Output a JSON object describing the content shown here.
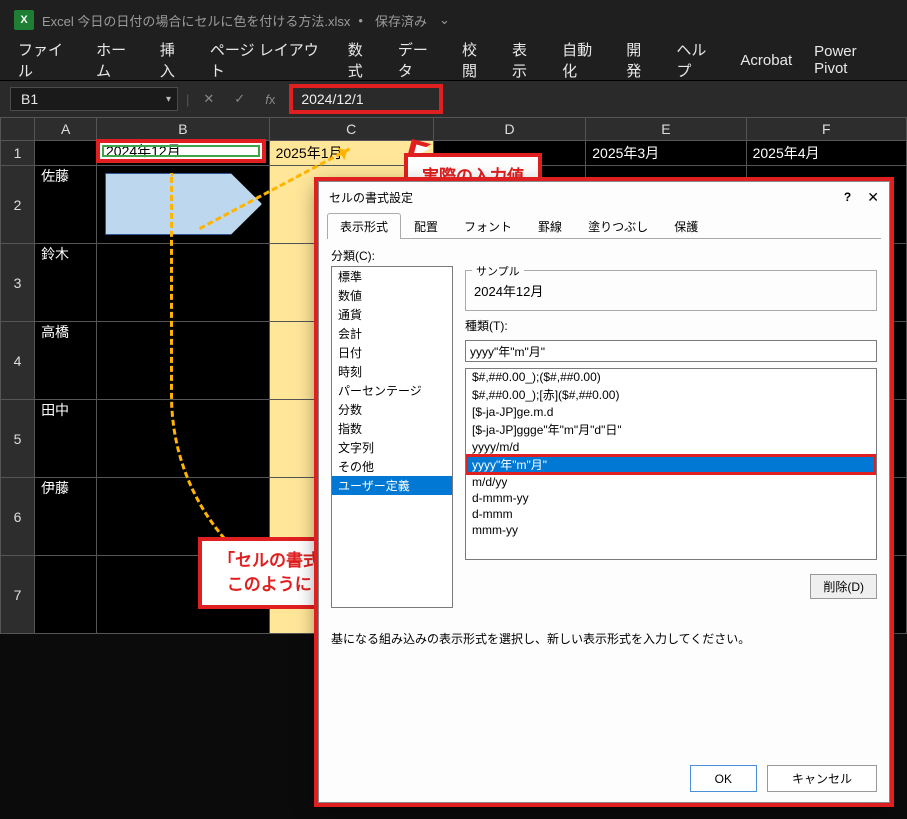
{
  "title": {
    "filename": "Excel 今日の日付の場合にセルに色を付ける方法.xlsx",
    "save_state": "保存済み"
  },
  "ribbon": [
    "ファイル",
    "ホーム",
    "挿入",
    "ページ レイアウト",
    "数式",
    "データ",
    "校閲",
    "表示",
    "自動化",
    "開発",
    "ヘルプ",
    "Acrobat",
    "Power Pivot"
  ],
  "namebox": "B1",
  "formula": "2024/12/1",
  "columns": [
    "A",
    "B",
    "C",
    "D",
    "E",
    "F"
  ],
  "row_headers": [
    "1",
    "2",
    "3",
    "4",
    "5",
    "6",
    "7"
  ],
  "header_row": {
    "B": "2024年12月",
    "C": "2025年1月",
    "D": "",
    "E": "2025年3月",
    "F": "2025年4月"
  },
  "names": [
    "佐藤",
    "鈴木",
    "高橋",
    "田中",
    "伊藤",
    ""
  ],
  "callouts": {
    "actual_value": "実際の入力値",
    "format_dialog_l1": "「セルの書式設定」は",
    "format_dialog_l2": "このようにしている"
  },
  "dialog": {
    "title": "セルの書式設定",
    "tabs": [
      "表示形式",
      "配置",
      "フォント",
      "罫線",
      "塗りつぶし",
      "保護"
    ],
    "active_tab": 0,
    "category_label": "分類(C):",
    "categories": [
      "標準",
      "数値",
      "通貨",
      "会計",
      "日付",
      "時刻",
      "パーセンテージ",
      "分数",
      "指数",
      "文字列",
      "その他",
      "ユーザー定義"
    ],
    "category_selected": 11,
    "sample_label": "サンプル",
    "sample_value": "2024年12月",
    "type_label": "種類(T):",
    "type_input": "yyyy\"年\"m\"月\"",
    "type_list": [
      "$#,##0.00_);($#,##0.00)",
      "$#,##0.00_);[赤]($#,##0.00)",
      "[$-ja-JP]ge.m.d",
      "[$-ja-JP]ggge\"年\"m\"月\"d\"日\"",
      "yyyy/m/d",
      "yyyy\"年\"m\"月\"",
      "m/d/yy",
      "d-mmm-yy",
      "d-mmm",
      "mmm-yy"
    ],
    "type_selected": 5,
    "delete_btn": "削除(D)",
    "hint": "基になる組み込みの表示形式を選択し、新しい表示形式を入力してください。",
    "ok": "OK",
    "cancel": "キャンセル"
  }
}
